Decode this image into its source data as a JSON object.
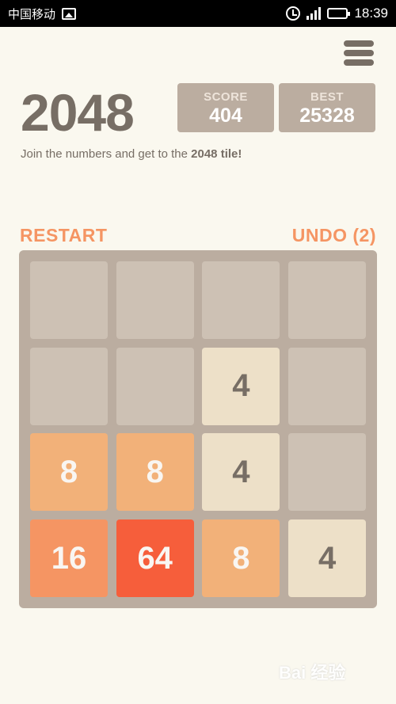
{
  "status_bar": {
    "carrier": "中国移动",
    "time": "18:39"
  },
  "header": {
    "title": "2048",
    "score_label": "SCORE",
    "score_value": "404",
    "best_label": "BEST",
    "best_value": "25328",
    "intro_prefix": "Join the numbers and get to the ",
    "intro_bold": "2048 tile!"
  },
  "actions": {
    "restart_label": "RESTART",
    "undo_label": "UNDO (2)"
  },
  "board": {
    "rows": [
      [
        null,
        null,
        null,
        null
      ],
      [
        null,
        null,
        "4",
        null
      ],
      [
        "8",
        "8",
        "4",
        null
      ],
      [
        "16",
        "64",
        "8",
        "4"
      ]
    ]
  },
  "colors": {
    "background": "#faf8ef",
    "board": "#bbada0",
    "empty_cell": "#cdc1b4",
    "accent": "#f59563",
    "tile_4": "#ede0c8",
    "tile_8": "#f2b179",
    "tile_16": "#f59563",
    "tile_64": "#f65e3b"
  },
  "watermark": {
    "text": "Bai 经验"
  }
}
